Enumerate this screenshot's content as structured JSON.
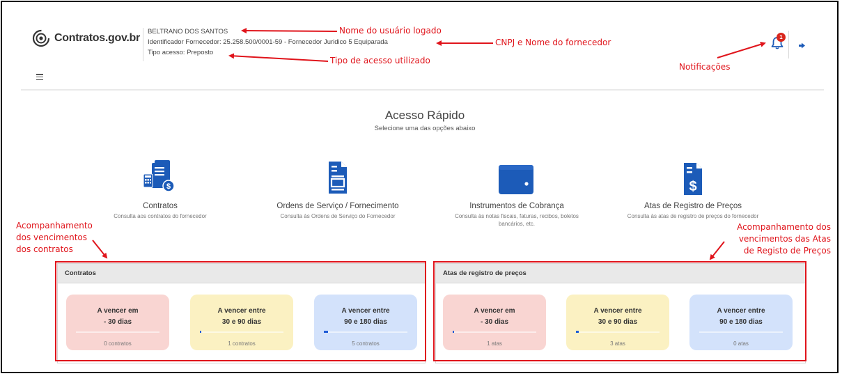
{
  "header": {
    "logo_text": "Contratos.gov.br",
    "user_name": "BELTRANO DOS SANTOS",
    "supplier_id": "Identificador Fornecedor: 25.258.500/0001-59 - Fornecedor Juridico 5 Equiparada",
    "access_type": "Tipo acesso: Preposto",
    "notification_count": "1"
  },
  "annotations": {
    "user": "Nome do usuário logado",
    "cnpj": "CNPJ e Nome do fornecedor",
    "access": "Tipo de acesso utilizado",
    "notifications": "Notificações",
    "contracts_tracking": "Acompanhamento\ndos vencimentos\ndos contratos",
    "atas_tracking": "Acompanhamento dos\nvencimentos das Atas\nde Registo de Preços"
  },
  "quick_access": {
    "title": "Acesso Rápido",
    "subtitle": "Selecione uma das opções abaixo",
    "cards": [
      {
        "title": "Contratos",
        "desc": "Consulta aos contratos do fornecedor"
      },
      {
        "title": "Ordens de Serviço / Fornecimento",
        "desc": "Consulta às Ordens de Serviço do Fornecedor"
      },
      {
        "title": "Instrumentos de Cobrança",
        "desc": "Consulta às notas fiscais, faturas, recibos, boletos bancários, etc."
      },
      {
        "title": "Atas de Registro de Preços",
        "desc": "Consulta às atas de registro de preços do fornecedor"
      }
    ]
  },
  "panels": {
    "contratos": {
      "title": "Contratos",
      "tiles": [
        {
          "line1": "A vencer em",
          "line2": "- 30 dias",
          "count": "0 contratos",
          "fill": 0.0,
          "color": "#f9d5d2"
        },
        {
          "line1": "A vencer entre",
          "line2": "30 e 90 dias",
          "count": "1 contratos",
          "fill": 0.02,
          "color": "#fbf1c2"
        },
        {
          "line1": "A vencer entre",
          "line2": "90 e 180 dias",
          "count": "5 contratos",
          "fill": 0.05,
          "color": "#d3e2fb"
        }
      ]
    },
    "atas": {
      "title": "Atas de registro de preços",
      "tiles": [
        {
          "line1": "A vencer em",
          "line2": "- 30 dias",
          "count": "1 atas",
          "fill": 0.02,
          "color": "#f9d5d2"
        },
        {
          "line1": "A vencer entre",
          "line2": "30 e 90 dias",
          "count": "3 atas",
          "fill": 0.03,
          "color": "#fbf1c2"
        },
        {
          "line1": "A vencer entre",
          "line2": "90 e 180 dias",
          "count": "0 atas",
          "fill": 0.0,
          "color": "#d3e2fb"
        }
      ]
    }
  },
  "colors": {
    "annotation": "#e0141b",
    "icon_blue": "#1c5bb8",
    "badge": "#d9261c"
  }
}
